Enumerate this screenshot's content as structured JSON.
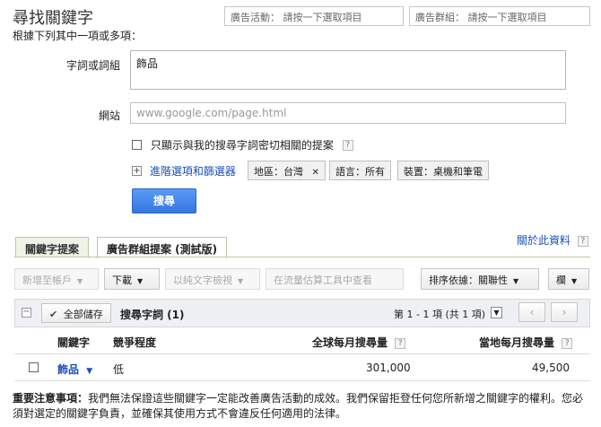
{
  "header": {
    "title": "尋找關鍵字",
    "subtitle": "根據下列其中一項或多項：",
    "campaign_picker": "廣告活動： 請按一下選取項目",
    "adgroup_picker": "廣告群組： 請按一下選取項目"
  },
  "form": {
    "keywords_label": "字詞或詞組",
    "keywords_value": "飾品",
    "website_label": "網站",
    "website_placeholder": "www.google.com/page.html",
    "close_match_label": "只顯示與我的搜尋字詞密切相關的提案",
    "advanced_link": "進階選項和篩選器",
    "filters": {
      "location": "地區：台灣",
      "language": "語言：所有",
      "device": "裝置：桌機和筆電"
    },
    "search_button": "搜尋",
    "help_glyph": "?",
    "plus_glyph": "+",
    "remove_glyph": "✕"
  },
  "tabs": {
    "keyword_ideas": "關鍵字提案",
    "adgroup_ideas": "廣告群組提案 (測試版)",
    "about_link": "關於此資料"
  },
  "toolbar": {
    "add_to_account": "新增至帳戶",
    "download": "下載",
    "view_as_text": "以純文字檢視",
    "traffic_estimator": "在流量估算工具中查看",
    "sort_by": "排序依據：關聯性",
    "columns": "欄"
  },
  "results": {
    "save_all": "全部儲存",
    "section_title": "搜尋字詞 (1)",
    "pagination": "第 1 - 1 項 (共 1 項)",
    "prev_glyph": "‹",
    "next_glyph": "›",
    "columns": {
      "keyword": "關鍵字",
      "competition": "競爭程度",
      "global_searches": "全球每月搜尋量",
      "local_searches": "當地每月搜尋量"
    },
    "rows": [
      {
        "keyword": "飾品",
        "competition": "低",
        "global": "301,000",
        "local": "49,500"
      }
    ]
  },
  "notice": {
    "bold_prefix": "重要注意事項：",
    "text": "我們無法保證這些關鍵字一定能改善廣告活動的成效。我們保留拒登任何您所新增之關鍵字的權利。您必須對選定的關鍵字負責，並確保其使用方式不會違反任何適用的法律。"
  },
  "colors": {
    "link": "#1a4fb4",
    "primary_button": "#3a7ee6",
    "tab_bg": "#eef3e8"
  }
}
